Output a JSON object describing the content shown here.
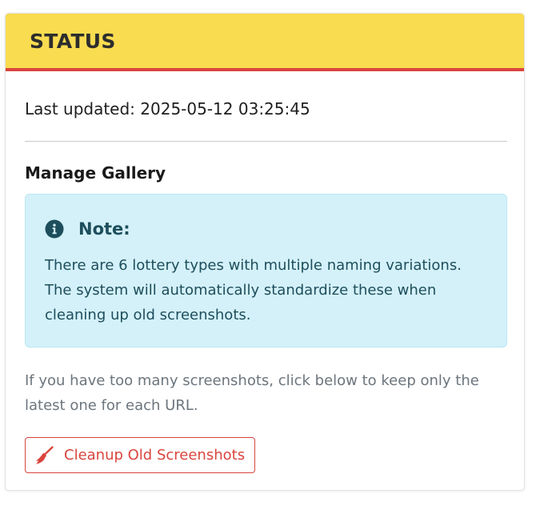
{
  "header": {
    "title": "STATUS",
    "bg_color": "#f9dc50",
    "accent_color": "#d9453d"
  },
  "status": {
    "last_updated": "Last updated: 2025-05-12 03:25:45"
  },
  "gallery": {
    "title": "Manage Gallery",
    "note": {
      "icon": "info-circle-icon",
      "title": "Note:",
      "text": "There are 6 lottery types with multiple naming variations. The system will automatically standardize these when cleaning up old screenshots.",
      "bg_color": "#d4f1f9",
      "text_color": "#1d4e5c"
    },
    "hint": "If you have too many screenshots, click below to keep only the latest one for each URL.",
    "cleanup_button": {
      "icon": "broom-icon",
      "label": "Cleanup Old Screenshots",
      "color": "#d9453d"
    }
  }
}
